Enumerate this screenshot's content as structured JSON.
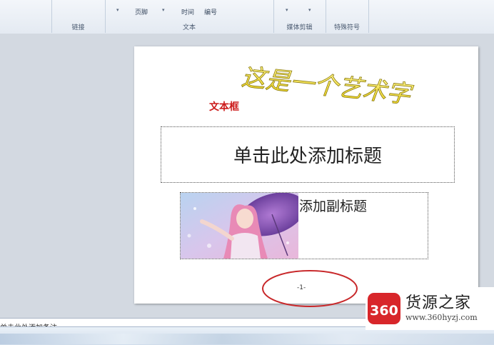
{
  "ribbon": {
    "groups": [
      {
        "label": "链接"
      },
      {
        "label": "文本"
      },
      {
        "label": "媒体剪辑"
      },
      {
        "label": "特殊符号"
      }
    ],
    "items": {
      "header_footer": "页脚",
      "datetime": "时间",
      "number": "编号"
    }
  },
  "slide": {
    "wordart_text": "这是一个艺术字",
    "textbox_label": "文本框",
    "title_placeholder": "单击此处添加标题",
    "subtitle_placeholder": "添加副标题",
    "page_number": "-1-"
  },
  "notes": {
    "placeholder": "单击此处添加备注"
  },
  "watermark": {
    "logo_text": "360",
    "name": "货源之家",
    "url": "www.360hyzj.com"
  },
  "colors": {
    "wordart_fill": "#f2e23a",
    "wordart_outline": "#8a7a10",
    "textbox_red": "#cc1a1a",
    "circle_red": "#c8282a",
    "logo_red": "#d8262a"
  }
}
